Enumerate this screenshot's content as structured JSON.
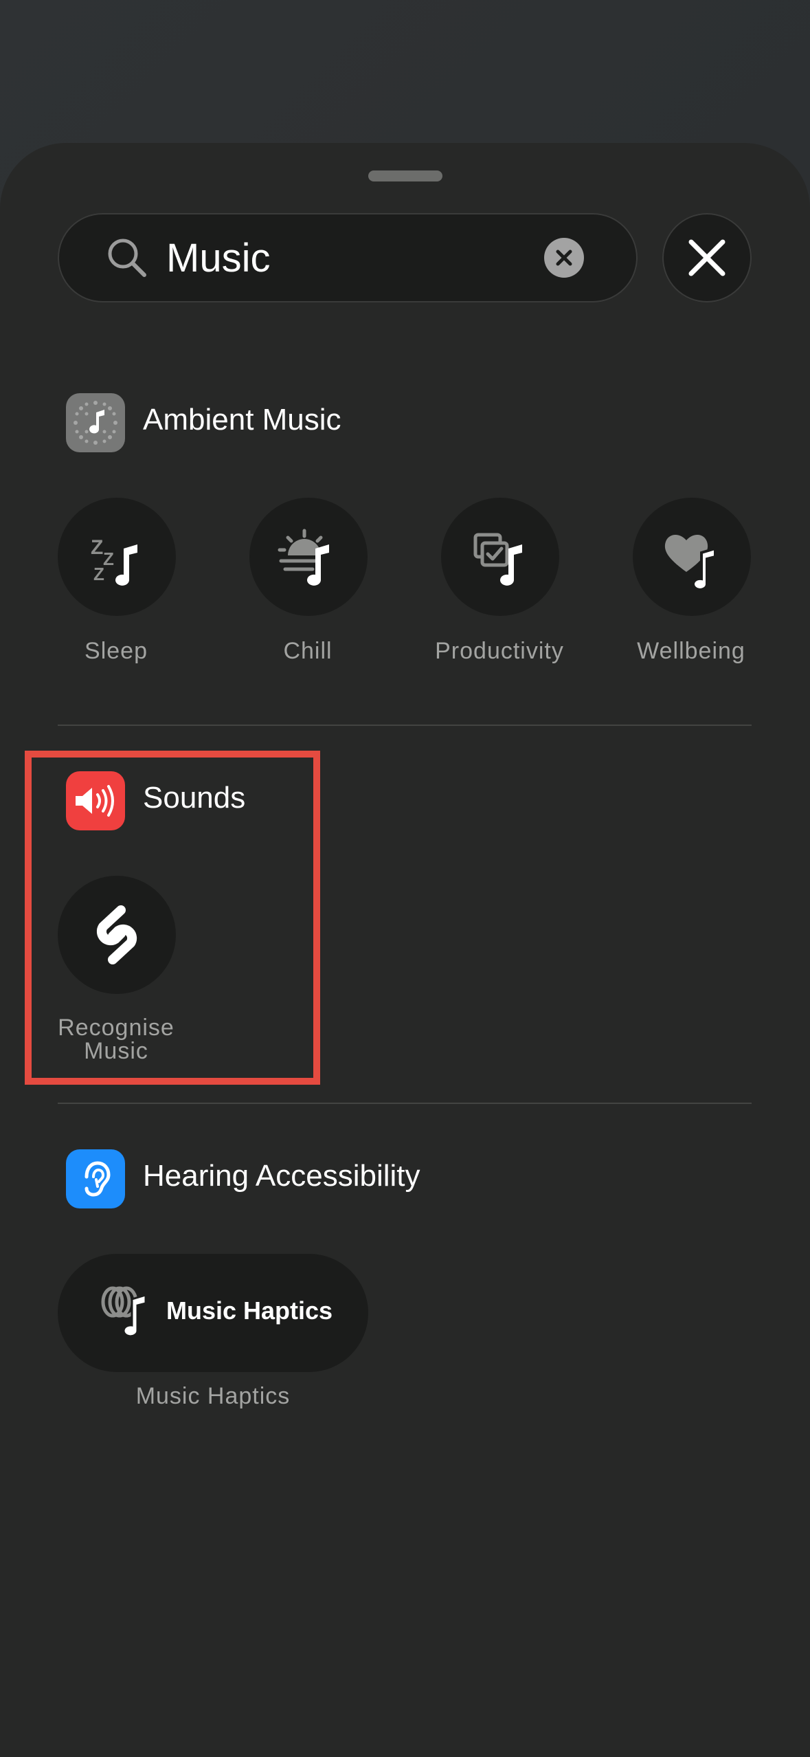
{
  "search": {
    "value": "Music",
    "placeholder": "Search"
  },
  "sections": [
    {
      "title": "Ambient Music",
      "icon": "ambient-music-app-icon",
      "items": [
        {
          "label": "Sleep",
          "icon": "sleep-music-icon"
        },
        {
          "label": "Chill",
          "icon": "chill-music-icon"
        },
        {
          "label": "Productivity",
          "icon": "productivity-music-icon"
        },
        {
          "label": "Wellbeing",
          "icon": "wellbeing-music-icon"
        }
      ]
    },
    {
      "title": "Sounds",
      "icon": "sounds-app-icon",
      "items": [
        {
          "label": "Recognise\nMusic",
          "icon": "shazam-icon"
        }
      ]
    },
    {
      "title": "Hearing Accessibility",
      "icon": "hearing-accessibility-app-icon",
      "items": [
        {
          "label": "Music Haptics",
          "caption": "Music Haptics",
          "icon": "music-haptics-icon"
        }
      ]
    }
  ],
  "colors": {
    "sheet": "#272827",
    "button": "#1b1c1b",
    "highlight": "#e54b40",
    "sounds_icon": "#f0403f",
    "hearing_icon": "#1d8dfb",
    "secondary_text": "#a3a4a2"
  }
}
